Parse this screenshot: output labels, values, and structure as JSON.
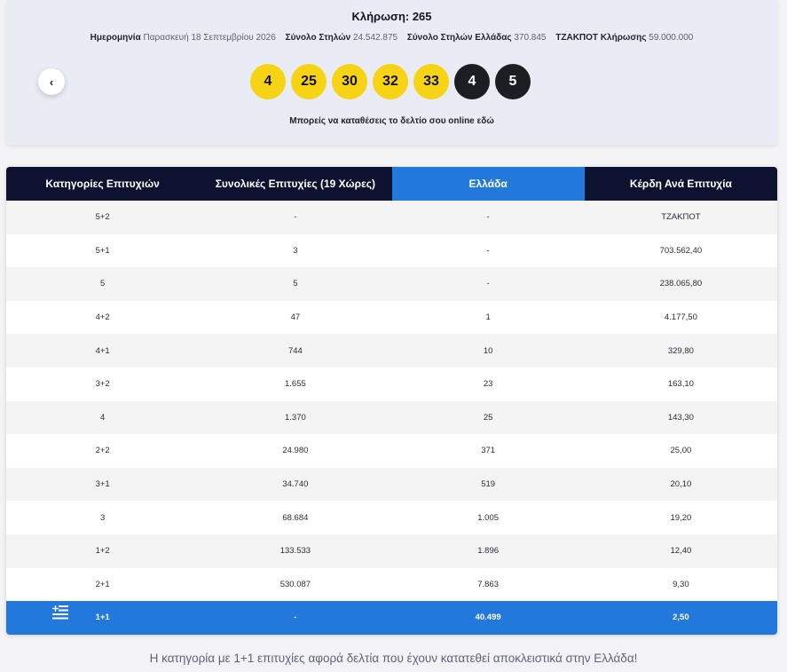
{
  "draw": {
    "title": "Κλήρωση: 265",
    "date_label": "Ημερομηνία",
    "date_value": "Παρασκευή 18 Σεπτεμβρίου 2026",
    "total_label": "Σύνολο Στηλών",
    "total_value": "24.542.875",
    "greece_label": "Σύνολο Στηλών Ελλάδας",
    "greece_value": "370.845",
    "jackpot_label": "ΤΖΑΚΠΟΤ Κλήρωσης",
    "jackpot_value": "59.000.000",
    "main_numbers": [
      "4",
      "25",
      "30",
      "32",
      "33"
    ],
    "star_numbers": [
      "4",
      "5"
    ],
    "prev_icon": "chevron-left-icon",
    "online_text": "Μπορείς να καταθέσεις το δελτίο σου online εδώ"
  },
  "table": {
    "headers": [
      "Κατηγορίες Επιτυχιών",
      "Συνολικές Επιτυχίες (19 Χώρες)",
      "Ελλάδα",
      "Κέρδη Ανά Επιτυχία"
    ],
    "rows": [
      [
        "5+2",
        "-",
        "-",
        "ΤΖΑΚΠΟΤ"
      ],
      [
        "5+1",
        "3",
        "-",
        "703.562,40"
      ],
      [
        "5",
        "5",
        "-",
        "238.065,80"
      ],
      [
        "4+2",
        "47",
        "1",
        "4.177,50"
      ],
      [
        "4+1",
        "744",
        "10",
        "329,80"
      ],
      [
        "3+2",
        "1.655",
        "23",
        "163,10"
      ],
      [
        "4",
        "1.370",
        "25",
        "143,30"
      ],
      [
        "2+2",
        "24.980",
        "371",
        "25,00"
      ],
      [
        "3+1",
        "34.740",
        "519",
        "20,10"
      ],
      [
        "3",
        "68.684",
        "1.005",
        "19,20"
      ],
      [
        "1+2",
        "133.533",
        "1.896",
        "12,40"
      ],
      [
        "2+1",
        "530.087",
        "7.863",
        "9,30"
      ]
    ],
    "special_row": [
      "1+1",
      "-",
      "40.499",
      "2,50"
    ],
    "special_icon": "greek-flag-icon",
    "colors": {
      "header": "#0c1230",
      "highlight": "#2378db",
      "main_ball": "#f6d314",
      "star_ball": "#1d1e24"
    }
  },
  "footnote": "Η κατηγορία με 1+1 επιτυχίες αφορά δελτία που έχουν κατατεθεί αποκλειστικά στην Ελλάδα!"
}
